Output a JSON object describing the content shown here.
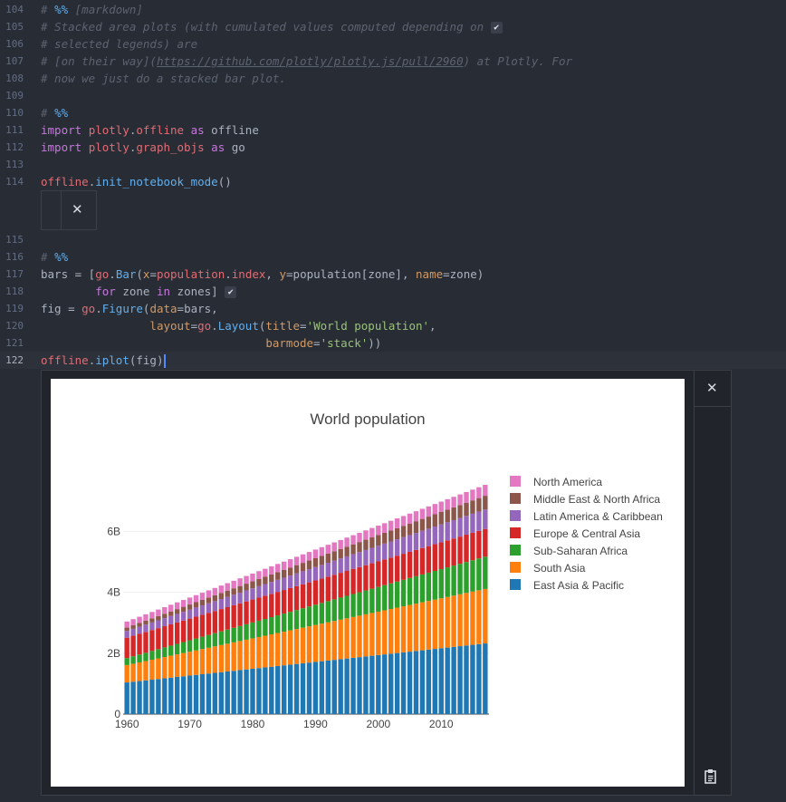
{
  "editor": {
    "lines": [
      {
        "num": "104",
        "segs": [
          [
            "cm",
            "# "
          ],
          [
            "cellmark",
            "%%"
          ],
          [
            "cm",
            " [markdown]"
          ]
        ]
      },
      {
        "num": "105",
        "segs": [
          [
            "cm",
            "# Stacked area plots (with cumulated values computed depending on "
          ],
          [
            "chk",
            "✔"
          ]
        ]
      },
      {
        "num": "106",
        "segs": [
          [
            "cm",
            "# selected legends) are"
          ]
        ]
      },
      {
        "num": "107",
        "segs": [
          [
            "cm",
            "# [on their way]("
          ],
          [
            "cmu",
            "https://github.com/plotly/plotly.js/pull/2960"
          ],
          [
            "cm",
            ") at Plotly. For"
          ]
        ]
      },
      {
        "num": "108",
        "segs": [
          [
            "cm",
            "# now we just do a stacked bar plot."
          ]
        ]
      },
      {
        "num": "109",
        "segs": []
      },
      {
        "num": "110",
        "segs": [
          [
            "cm",
            "# "
          ],
          [
            "cellmark",
            "%%"
          ]
        ]
      },
      {
        "num": "111",
        "segs": [
          [
            "kw",
            "import"
          ],
          [
            "tx",
            " "
          ],
          [
            "rd",
            "plotly"
          ],
          [
            "tx",
            "."
          ],
          [
            "rd",
            "offline"
          ],
          [
            "tx",
            " "
          ],
          [
            "kw",
            "as"
          ],
          [
            "tx",
            " offline"
          ]
        ]
      },
      {
        "num": "112",
        "segs": [
          [
            "kw",
            "import"
          ],
          [
            "tx",
            " "
          ],
          [
            "rd",
            "plotly"
          ],
          [
            "tx",
            "."
          ],
          [
            "rd",
            "graph_objs"
          ],
          [
            "tx",
            " "
          ],
          [
            "kw",
            "as"
          ],
          [
            "tx",
            " go"
          ]
        ]
      },
      {
        "num": "113",
        "segs": []
      },
      {
        "num": "114",
        "segs": [
          [
            "rd",
            "offline"
          ],
          [
            "tx",
            "."
          ],
          [
            "fn",
            "init_notebook_mode"
          ],
          [
            "tx",
            "()"
          ]
        ]
      },
      {
        "num": "115",
        "segs": []
      },
      {
        "num": "116",
        "segs": [
          [
            "cm",
            "# "
          ],
          [
            "cellmark",
            "%%"
          ]
        ]
      },
      {
        "num": "117",
        "segs": [
          [
            "tx",
            "bars = ["
          ],
          [
            "rd",
            "go"
          ],
          [
            "tx",
            "."
          ],
          [
            "fn",
            "Bar"
          ],
          [
            "tx",
            "("
          ],
          [
            "nm",
            "x"
          ],
          [
            "tx",
            "="
          ],
          [
            "rd",
            "population"
          ],
          [
            "tx",
            "."
          ],
          [
            "rd",
            "index"
          ],
          [
            "tx",
            ", "
          ],
          [
            "nm",
            "y"
          ],
          [
            "tx",
            "=population[zone], "
          ],
          [
            "nm",
            "name"
          ],
          [
            "tx",
            "=zone)"
          ]
        ]
      },
      {
        "num": "118",
        "segs": [
          [
            "tx",
            "        "
          ],
          [
            "kw",
            "for"
          ],
          [
            "tx",
            " zone "
          ],
          [
            "kw",
            "in"
          ],
          [
            "tx",
            " zones] "
          ],
          [
            "chk",
            "✔"
          ]
        ]
      },
      {
        "num": "119",
        "segs": [
          [
            "tx",
            "fig = "
          ],
          [
            "rd",
            "go"
          ],
          [
            "tx",
            "."
          ],
          [
            "fn",
            "Figure"
          ],
          [
            "tx",
            "("
          ],
          [
            "nm",
            "data"
          ],
          [
            "tx",
            "=bars,"
          ]
        ]
      },
      {
        "num": "120",
        "segs": [
          [
            "tx",
            "                "
          ],
          [
            "nm",
            "layout"
          ],
          [
            "tx",
            "="
          ],
          [
            "rd",
            "go"
          ],
          [
            "tx",
            "."
          ],
          [
            "fn",
            "Layout"
          ],
          [
            "tx",
            "("
          ],
          [
            "nm",
            "title"
          ],
          [
            "tx",
            "="
          ],
          [
            "st",
            "'World population'"
          ],
          [
            "tx",
            ","
          ]
        ]
      },
      {
        "num": "121",
        "segs": [
          [
            "tx",
            "                                 "
          ],
          [
            "nm",
            "barmode"
          ],
          [
            "tx",
            "="
          ],
          [
            "st",
            "'stack'"
          ],
          [
            "tx",
            "))"
          ]
        ]
      },
      {
        "num": "122",
        "segs": [
          [
            "rd",
            "offline"
          ],
          [
            "tx",
            "."
          ],
          [
            "fn",
            "iplot"
          ],
          [
            "tx",
            "(fig)"
          ],
          [
            "cur",
            ""
          ]
        ]
      }
    ]
  },
  "output": {
    "close_icon": "✕",
    "copy_icon": "clipboard-icon"
  },
  "chart_data": {
    "type": "bar",
    "barmode": "stack",
    "title": "World population",
    "xlabel": "",
    "ylabel": "",
    "x_range": [
      1960,
      2017
    ],
    "x_ticks": [
      1960,
      1970,
      1980,
      1990,
      2000,
      2010
    ],
    "y_ticks": [
      0,
      2,
      4,
      6
    ],
    "y_tick_labels": [
      "0",
      "2B",
      "4B",
      "6B"
    ],
    "ylim": [
      0,
      7.5
    ],
    "legend_position": "right",
    "x_start": 1960,
    "x_end": 2017,
    "series": [
      {
        "name": "East Asia & Pacific",
        "color": "#1f77b4",
        "start": 1.04,
        "end": 2.32
      },
      {
        "name": "South Asia",
        "color": "#ff7f0e",
        "start": 0.57,
        "end": 1.79
      },
      {
        "name": "Sub-Saharan Africa",
        "color": "#2ca02c",
        "start": 0.23,
        "end": 1.06
      },
      {
        "name": "Europe & Central Asia",
        "color": "#d62728",
        "start": 0.67,
        "end": 0.91
      },
      {
        "name": "Latin America & Caribbean",
        "color": "#9467bd",
        "start": 0.22,
        "end": 0.64
      },
      {
        "name": "Middle East & North Africa",
        "color": "#8c564b",
        "start": 0.11,
        "end": 0.45
      },
      {
        "name": "North America",
        "color": "#e377c2",
        "start": 0.2,
        "end": 0.36
      }
    ]
  }
}
